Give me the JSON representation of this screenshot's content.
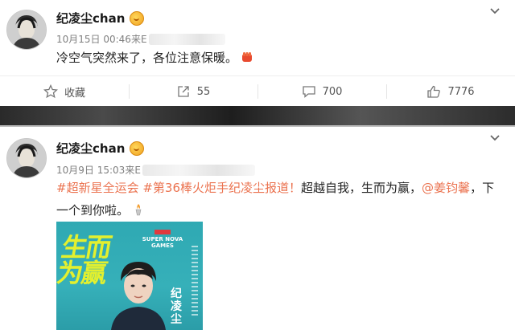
{
  "posts": [
    {
      "username": "纪凌尘chan",
      "timestamp": "10月15日 00:46",
      "source_prefix": "来E",
      "text": "冷空气突然来了，各位注意保暖。",
      "actions": {
        "favorite": "收藏",
        "repost": "55",
        "comment": "700",
        "like": "7776"
      },
      "icons": [
        "chevron-down-icon",
        "star-icon",
        "share-icon",
        "comment-icon",
        "like-icon",
        "fist-emoji-icon"
      ]
    },
    {
      "username": "纪凌尘chan",
      "timestamp": "10月9日 15:03",
      "source_prefix": "来E",
      "text": {
        "topic1": "#超新星全运会",
        "topic2": "#第36棒火炬手纪凌尘报道！",
        "body": "超越自我，生而为赢，",
        "mention": "@姜钧馨",
        "tail_line1": "，下",
        "tail_line2": "一个到你啦。"
      },
      "poster": {
        "slogan": "生而为赢",
        "logo_text": "SUPER NOVA GAMES",
        "name": "纪凌尘"
      },
      "icons": [
        "chevron-down-icon",
        "torch-emoji-icon"
      ]
    }
  ],
  "colors": {
    "link": "#eb7350",
    "poster_bg": "#2fa9b3",
    "poster_slogan": "#e3f02e"
  }
}
